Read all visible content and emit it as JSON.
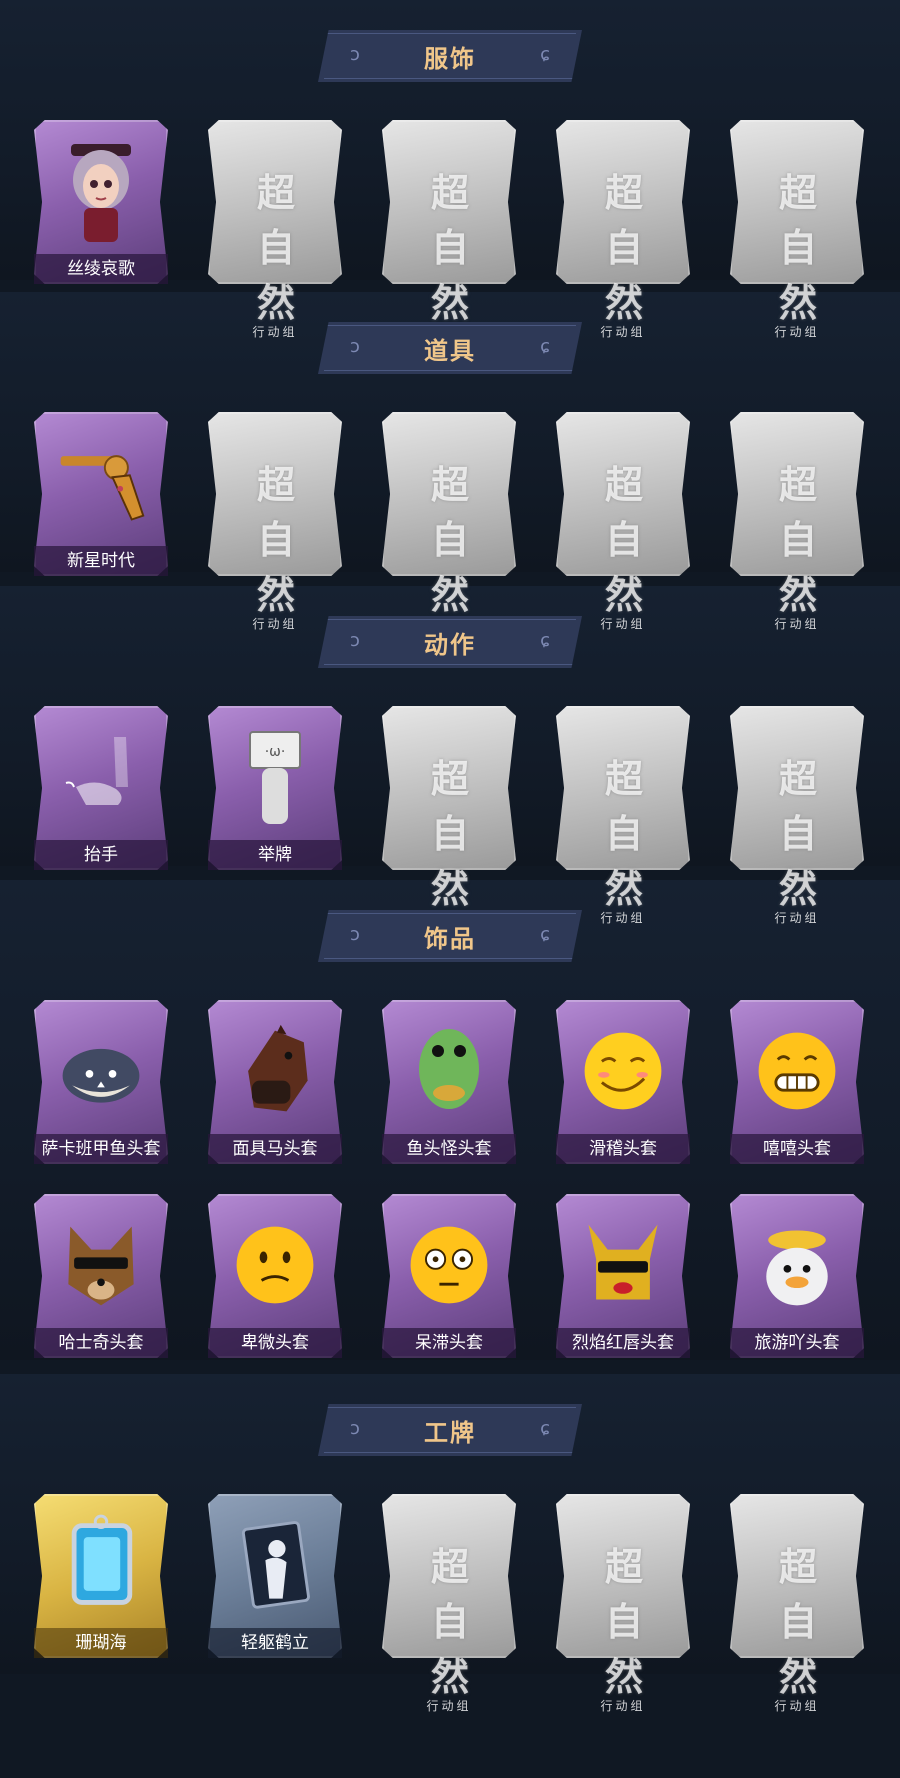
{
  "placeholder": {
    "main": "超自然",
    "sub": "行动组"
  },
  "sections": [
    {
      "title": "服饰",
      "rows": [
        [
          {
            "state": "owned",
            "label": "丝绫哀歌",
            "icon": "girl-portrait-icon"
          },
          {
            "state": "locked"
          },
          {
            "state": "locked"
          },
          {
            "state": "locked"
          },
          {
            "state": "locked"
          }
        ]
      ]
    },
    {
      "title": "道具",
      "rows": [
        [
          {
            "state": "owned",
            "label": "新星时代",
            "icon": "revolver-icon"
          },
          {
            "state": "locked"
          },
          {
            "state": "locked"
          },
          {
            "state": "locked"
          },
          {
            "state": "locked"
          }
        ]
      ]
    },
    {
      "title": "动作",
      "rows": [
        [
          {
            "state": "owned",
            "label": "抬手",
            "icon": "raise-hand-icon"
          },
          {
            "state": "owned",
            "label": "举牌",
            "icon": "hold-sign-icon"
          },
          {
            "state": "locked"
          },
          {
            "state": "locked"
          },
          {
            "state": "locked"
          }
        ]
      ]
    },
    {
      "title": "饰品",
      "rows": [
        [
          {
            "state": "owned",
            "label": "萨卡班甲鱼头套",
            "icon": "fish-head-icon"
          },
          {
            "state": "owned",
            "label": "面具马头套",
            "icon": "horse-mask-icon"
          },
          {
            "state": "owned",
            "label": "鱼头怪头套",
            "icon": "fishman-head-icon"
          },
          {
            "state": "owned",
            "label": "滑稽头套",
            "icon": "funny-face-icon"
          },
          {
            "state": "owned",
            "label": "嘻嘻头套",
            "icon": "grin-face-icon"
          }
        ],
        [
          {
            "state": "owned",
            "label": "哈士奇头套",
            "icon": "husky-head-icon"
          },
          {
            "state": "owned",
            "label": "卑微头套",
            "icon": "humble-face-icon"
          },
          {
            "state": "owned",
            "label": "呆滞头套",
            "icon": "stunned-face-icon"
          },
          {
            "state": "owned",
            "label": "烈焰红唇头套",
            "icon": "red-lips-head-icon"
          },
          {
            "state": "owned",
            "label": "旅游吖头套",
            "icon": "travel-duck-icon"
          }
        ]
      ]
    },
    {
      "title": "工牌",
      "rows": [
        [
          {
            "state": "gold",
            "label": "珊瑚海",
            "icon": "coral-badge-icon"
          },
          {
            "state": "slate",
            "label": "轻躯鹤立",
            "icon": "silhouette-badge-icon"
          },
          {
            "state": "locked"
          },
          {
            "state": "locked"
          },
          {
            "state": "locked"
          }
        ]
      ]
    }
  ]
}
